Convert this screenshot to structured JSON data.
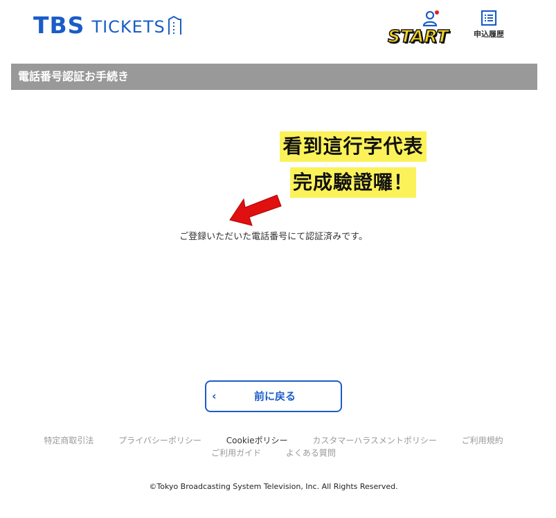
{
  "header": {
    "logo_main": "TBS",
    "logo_sub": "TICKETS",
    "start_logo": "START",
    "history_label": "申込履歴"
  },
  "section": {
    "title": "電話番号認証お手続き"
  },
  "annotation": {
    "line1": "看到這行字代表",
    "line2": "完成驗證囉！"
  },
  "main": {
    "verified_message": "ご登録いただいた電話番号にて認証済みです。",
    "back_button_label": "前に戻る",
    "back_chevron": "‹"
  },
  "footer": {
    "links": [
      "特定商取引法",
      "プライバシーポリシー",
      "Cookieポリシー",
      "カスタマーハラスメントポリシー",
      "ご利用規約",
      "ご利用ガイド",
      "よくある質問"
    ],
    "copyright": "©Tokyo Broadcasting System Television, Inc. All Rights Reserved."
  },
  "colors": {
    "brand_blue": "#1a5cc8",
    "section_gray": "#999999",
    "highlight_yellow": "#fbf25a",
    "arrow_red": "#e01010",
    "notification_red": "#e02020"
  }
}
